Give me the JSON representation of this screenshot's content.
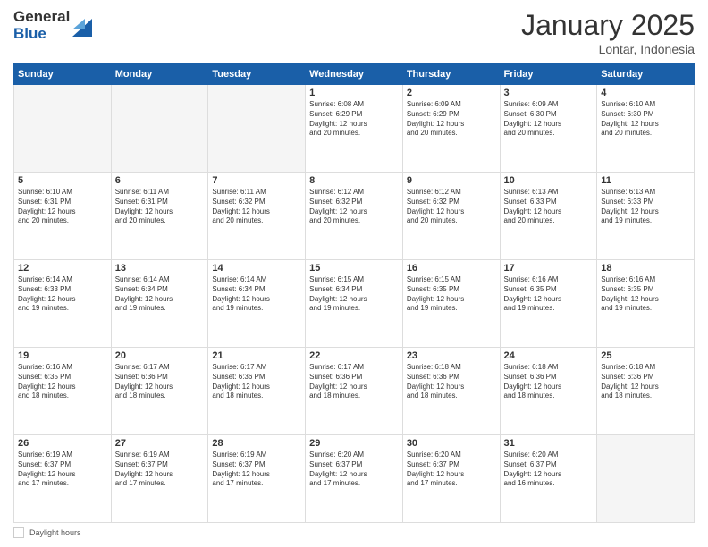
{
  "logo": {
    "line1": "General",
    "line2": "Blue"
  },
  "header": {
    "month": "January 2025",
    "location": "Lontar, Indonesia"
  },
  "weekdays": [
    "Sunday",
    "Monday",
    "Tuesday",
    "Wednesday",
    "Thursday",
    "Friday",
    "Saturday"
  ],
  "footer": {
    "daylight_label": "Daylight hours"
  },
  "weeks": [
    [
      {
        "day": "",
        "info": ""
      },
      {
        "day": "",
        "info": ""
      },
      {
        "day": "",
        "info": ""
      },
      {
        "day": "1",
        "info": "Sunrise: 6:08 AM\nSunset: 6:29 PM\nDaylight: 12 hours\nand 20 minutes."
      },
      {
        "day": "2",
        "info": "Sunrise: 6:09 AM\nSunset: 6:29 PM\nDaylight: 12 hours\nand 20 minutes."
      },
      {
        "day": "3",
        "info": "Sunrise: 6:09 AM\nSunset: 6:30 PM\nDaylight: 12 hours\nand 20 minutes."
      },
      {
        "day": "4",
        "info": "Sunrise: 6:10 AM\nSunset: 6:30 PM\nDaylight: 12 hours\nand 20 minutes."
      }
    ],
    [
      {
        "day": "5",
        "info": "Sunrise: 6:10 AM\nSunset: 6:31 PM\nDaylight: 12 hours\nand 20 minutes."
      },
      {
        "day": "6",
        "info": "Sunrise: 6:11 AM\nSunset: 6:31 PM\nDaylight: 12 hours\nand 20 minutes."
      },
      {
        "day": "7",
        "info": "Sunrise: 6:11 AM\nSunset: 6:32 PM\nDaylight: 12 hours\nand 20 minutes."
      },
      {
        "day": "8",
        "info": "Sunrise: 6:12 AM\nSunset: 6:32 PM\nDaylight: 12 hours\nand 20 minutes."
      },
      {
        "day": "9",
        "info": "Sunrise: 6:12 AM\nSunset: 6:32 PM\nDaylight: 12 hours\nand 20 minutes."
      },
      {
        "day": "10",
        "info": "Sunrise: 6:13 AM\nSunset: 6:33 PM\nDaylight: 12 hours\nand 20 minutes."
      },
      {
        "day": "11",
        "info": "Sunrise: 6:13 AM\nSunset: 6:33 PM\nDaylight: 12 hours\nand 19 minutes."
      }
    ],
    [
      {
        "day": "12",
        "info": "Sunrise: 6:14 AM\nSunset: 6:33 PM\nDaylight: 12 hours\nand 19 minutes."
      },
      {
        "day": "13",
        "info": "Sunrise: 6:14 AM\nSunset: 6:34 PM\nDaylight: 12 hours\nand 19 minutes."
      },
      {
        "day": "14",
        "info": "Sunrise: 6:14 AM\nSunset: 6:34 PM\nDaylight: 12 hours\nand 19 minutes."
      },
      {
        "day": "15",
        "info": "Sunrise: 6:15 AM\nSunset: 6:34 PM\nDaylight: 12 hours\nand 19 minutes."
      },
      {
        "day": "16",
        "info": "Sunrise: 6:15 AM\nSunset: 6:35 PM\nDaylight: 12 hours\nand 19 minutes."
      },
      {
        "day": "17",
        "info": "Sunrise: 6:16 AM\nSunset: 6:35 PM\nDaylight: 12 hours\nand 19 minutes."
      },
      {
        "day": "18",
        "info": "Sunrise: 6:16 AM\nSunset: 6:35 PM\nDaylight: 12 hours\nand 19 minutes."
      }
    ],
    [
      {
        "day": "19",
        "info": "Sunrise: 6:16 AM\nSunset: 6:35 PM\nDaylight: 12 hours\nand 18 minutes."
      },
      {
        "day": "20",
        "info": "Sunrise: 6:17 AM\nSunset: 6:36 PM\nDaylight: 12 hours\nand 18 minutes."
      },
      {
        "day": "21",
        "info": "Sunrise: 6:17 AM\nSunset: 6:36 PM\nDaylight: 12 hours\nand 18 minutes."
      },
      {
        "day": "22",
        "info": "Sunrise: 6:17 AM\nSunset: 6:36 PM\nDaylight: 12 hours\nand 18 minutes."
      },
      {
        "day": "23",
        "info": "Sunrise: 6:18 AM\nSunset: 6:36 PM\nDaylight: 12 hours\nand 18 minutes."
      },
      {
        "day": "24",
        "info": "Sunrise: 6:18 AM\nSunset: 6:36 PM\nDaylight: 12 hours\nand 18 minutes."
      },
      {
        "day": "25",
        "info": "Sunrise: 6:18 AM\nSunset: 6:36 PM\nDaylight: 12 hours\nand 18 minutes."
      }
    ],
    [
      {
        "day": "26",
        "info": "Sunrise: 6:19 AM\nSunset: 6:37 PM\nDaylight: 12 hours\nand 17 minutes."
      },
      {
        "day": "27",
        "info": "Sunrise: 6:19 AM\nSunset: 6:37 PM\nDaylight: 12 hours\nand 17 minutes."
      },
      {
        "day": "28",
        "info": "Sunrise: 6:19 AM\nSunset: 6:37 PM\nDaylight: 12 hours\nand 17 minutes."
      },
      {
        "day": "29",
        "info": "Sunrise: 6:20 AM\nSunset: 6:37 PM\nDaylight: 12 hours\nand 17 minutes."
      },
      {
        "day": "30",
        "info": "Sunrise: 6:20 AM\nSunset: 6:37 PM\nDaylight: 12 hours\nand 17 minutes."
      },
      {
        "day": "31",
        "info": "Sunrise: 6:20 AM\nSunset: 6:37 PM\nDaylight: 12 hours\nand 16 minutes."
      },
      {
        "day": "",
        "info": ""
      }
    ]
  ]
}
